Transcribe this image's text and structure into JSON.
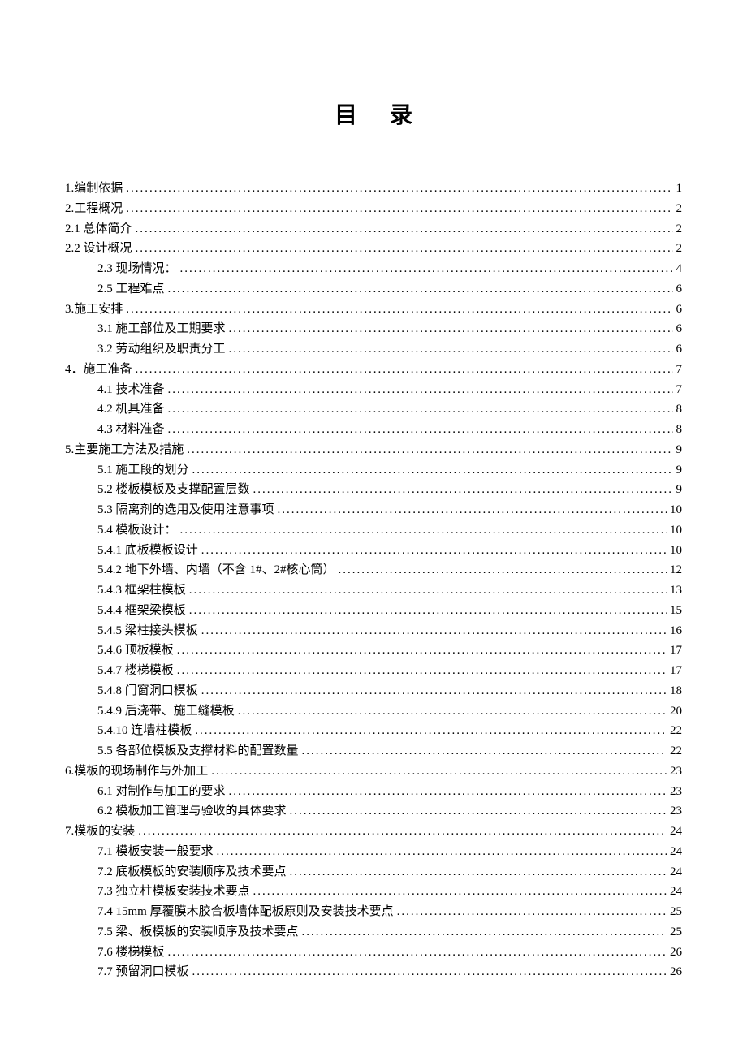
{
  "title": "目录",
  "toc": [
    {
      "level": 0,
      "label": "1.编制依据",
      "page": "1"
    },
    {
      "level": 0,
      "label": "2.工程概况",
      "page": "2"
    },
    {
      "level": 0,
      "label": "2.1 总体简介",
      "page": "2"
    },
    {
      "level": 0,
      "label": "2.2 设计概况",
      "page": "2"
    },
    {
      "level": 1,
      "label": "2.3 现场情况：",
      "page": "4"
    },
    {
      "level": 1,
      "label": "2.5 工程难点",
      "page": "6"
    },
    {
      "level": 0,
      "label": "3.施工安排",
      "page": "6"
    },
    {
      "level": 1,
      "label": "3.1 施工部位及工期要求",
      "page": "6"
    },
    {
      "level": 1,
      "label": "3.2 劳动组织及职责分工",
      "page": "6"
    },
    {
      "level": 0,
      "label": "4．施工准备",
      "page": "7"
    },
    {
      "level": 1,
      "label": "4.1 技术准备",
      "page": "7"
    },
    {
      "level": 1,
      "label": "4.2 机具准备",
      "page": "8"
    },
    {
      "level": 1,
      "label": "4.3 材料准备",
      "page": "8"
    },
    {
      "level": 0,
      "label": "5.主要施工方法及措施",
      "page": "9"
    },
    {
      "level": 1,
      "label": "5.1 施工段的划分",
      "page": "9"
    },
    {
      "level": 1,
      "label": "5.2 楼板模板及支撑配置层数",
      "page": "9"
    },
    {
      "level": 1,
      "label": "5.3 隔离剂的选用及使用注意事项",
      "page": "10"
    },
    {
      "level": 1,
      "label": "5.4 模板设计：",
      "page": "10"
    },
    {
      "level": 1,
      "label": "5.4.1 底板模板设计",
      "page": "10"
    },
    {
      "level": 1,
      "label": "5.4.2 地下外墙、内墙（不含 1#、2#核心筒）",
      "page": "12"
    },
    {
      "level": 1,
      "label": "5.4.3 框架柱模板",
      "page": "13"
    },
    {
      "level": 1,
      "label": "5.4.4 框架梁模板",
      "page": "15"
    },
    {
      "level": 1,
      "label": "5.4.5 梁柱接头模板",
      "page": "16"
    },
    {
      "level": 1,
      "label": "5.4.6 顶板模板",
      "page": "17"
    },
    {
      "level": 1,
      "label": "5.4.7 楼梯模板",
      "page": "17"
    },
    {
      "level": 1,
      "label": "5.4.8 门窗洞口模板",
      "page": "18"
    },
    {
      "level": 1,
      "label": "5.4.9 后浇带、施工缝模板",
      "page": "20"
    },
    {
      "level": 1,
      "label": "5.4.10 连墙柱模板",
      "page": "22"
    },
    {
      "level": 1,
      "label": "5.5 各部位模板及支撑材料的配置数量",
      "page": "22"
    },
    {
      "level": 0,
      "label": "6.模板的现场制作与外加工",
      "page": "23"
    },
    {
      "level": 1,
      "label": "6.1 对制作与加工的要求",
      "page": "23"
    },
    {
      "level": 1,
      "label": "6.2 模板加工管理与验收的具体要求",
      "page": "23"
    },
    {
      "level": 0,
      "label": "7.模板的安装",
      "page": "24"
    },
    {
      "level": 1,
      "label": "7.1 模板安装一般要求",
      "page": "24"
    },
    {
      "level": 1,
      "label": "7.2 底板模板的安装顺序及技术要点",
      "page": "24"
    },
    {
      "level": 1,
      "label": "7.3  独立柱模板安装技术要点",
      "page": "24"
    },
    {
      "level": 1,
      "label": "7.4 15mm 厚覆膜木胶合板墙体配板原则及安装技术要点",
      "page": "25"
    },
    {
      "level": 1,
      "label": "7.5 梁、板模板的安装顺序及技术要点",
      "page": "25"
    },
    {
      "level": 1,
      "label": "7.6  楼梯模板",
      "page": "26"
    },
    {
      "level": 1,
      "label": "7.7  预留洞口模板",
      "page": "26"
    }
  ]
}
